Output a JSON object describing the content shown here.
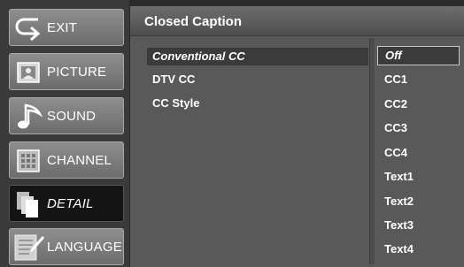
{
  "sidebar": {
    "items": [
      {
        "label": "EXIT",
        "icon": "exit-arrow-icon"
      },
      {
        "label": "PICTURE",
        "icon": "picture-icon"
      },
      {
        "label": "SOUND",
        "icon": "music-note-icon"
      },
      {
        "label": "CHANNEL",
        "icon": "channel-grid-icon"
      },
      {
        "label": "DETAIL",
        "icon": "detail-pages-icon",
        "active": true
      },
      {
        "label": "LANGUAGE",
        "icon": "language-document-icon"
      }
    ]
  },
  "panel": {
    "title": "Closed Caption",
    "options": [
      {
        "label": "Conventional CC",
        "selected": true
      },
      {
        "label": "DTV CC"
      },
      {
        "label": "CC Style"
      }
    ],
    "values": [
      {
        "label": "Off",
        "selected": true
      },
      {
        "label": "CC1"
      },
      {
        "label": "CC2"
      },
      {
        "label": "CC3"
      },
      {
        "label": "CC4"
      },
      {
        "label": "Text1"
      },
      {
        "label": "Text2"
      },
      {
        "label": "Text3"
      },
      {
        "label": "Text4"
      }
    ]
  }
}
